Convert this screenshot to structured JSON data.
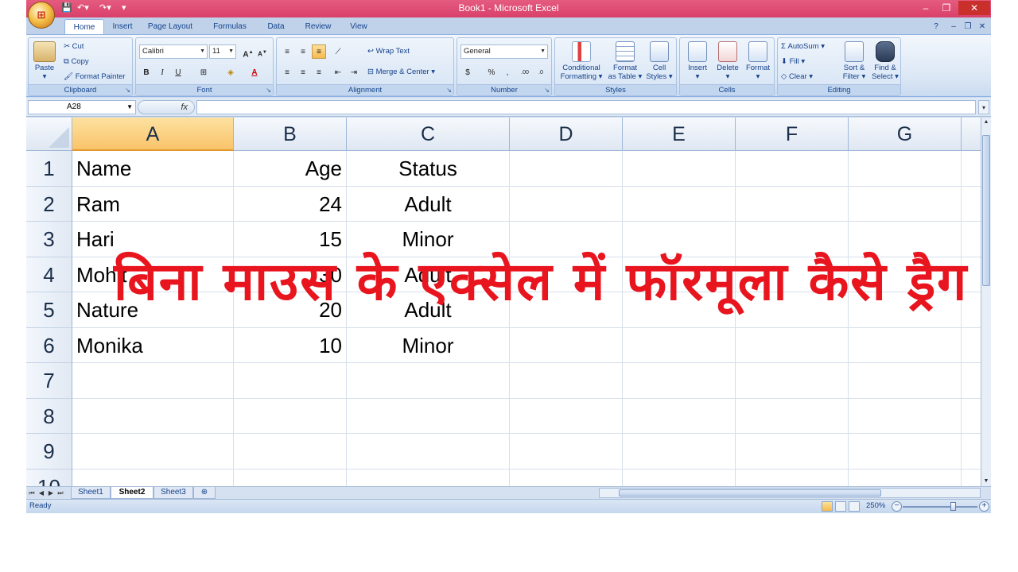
{
  "window": {
    "title": "Book1 - Microsoft Excel"
  },
  "ribbon": {
    "tabs": [
      "Home",
      "Insert",
      "Page Layout",
      "Formulas",
      "Data",
      "Review",
      "View"
    ],
    "active_tab": "Home",
    "clipboard": {
      "paste": "Paste",
      "cut": "Cut",
      "copy": "Copy",
      "format_painter": "Format Painter",
      "label": "Clipboard"
    },
    "font": {
      "family": "Calibri",
      "size": "11",
      "bold": "B",
      "italic": "I",
      "underline": "U",
      "label": "Font"
    },
    "alignment": {
      "wrap_text": "Wrap Text",
      "merge_center": "Merge & Center",
      "label": "Alignment"
    },
    "number": {
      "format": "General",
      "currency": "$",
      "percent": "%",
      "comma": ",",
      "label": "Number"
    },
    "styles": {
      "conditional_1": "Conditional",
      "conditional_2": "Formatting",
      "format_1": "Format",
      "format_2": "as Table",
      "cell_1": "Cell",
      "cell_2": "Styles",
      "label": "Styles"
    },
    "cells": {
      "insert": "Insert",
      "delete": "Delete",
      "format": "Format",
      "label": "Cells"
    },
    "editing": {
      "autosum": "AutoSum",
      "fill": "Fill",
      "clear": "Clear",
      "sort_1": "Sort &",
      "sort_2": "Filter",
      "find_1": "Find &",
      "find_2": "Select",
      "label": "Editing"
    }
  },
  "formula_bar": {
    "name_box": "A28",
    "fx": "fx",
    "value": ""
  },
  "grid": {
    "columns": [
      "A",
      "B",
      "C",
      "D",
      "E",
      "F",
      "G"
    ],
    "selected_column": "A",
    "rows": [
      "1",
      "2",
      "3",
      "4",
      "5",
      "6",
      "7",
      "8",
      "9",
      "10"
    ],
    "cells": [
      [
        "Name",
        "Age",
        "Status"
      ],
      [
        "Ram",
        "24",
        "Adult"
      ],
      [
        "Hari",
        "15",
        "Minor"
      ],
      [
        "Mohit",
        "30",
        "Adult"
      ],
      [
        "Nature",
        "20",
        "Adult"
      ],
      [
        "Monika",
        "10",
        "Minor"
      ]
    ]
  },
  "overlay_text": "बिना माउस के एक्सेल में फॉरमूला कैसे ड्रैग करें",
  "sheets": {
    "tabs": [
      "Sheet1",
      "Sheet2",
      "Sheet3"
    ],
    "active": "Sheet2"
  },
  "status": {
    "mode": "Ready",
    "zoom": "250%"
  },
  "colors": {
    "title_bar": "#e04a73",
    "overlay_text": "#e8141e",
    "selected_header": "#f9c46a"
  }
}
